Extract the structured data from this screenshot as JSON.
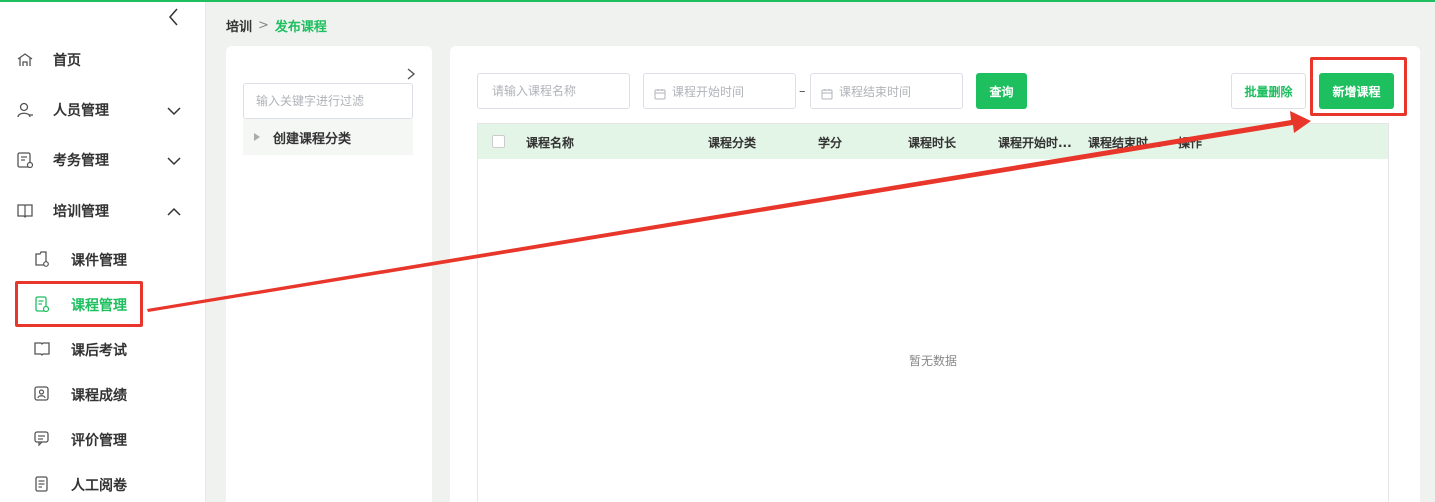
{
  "breadcrumb": {
    "level1": "培训",
    "separator": ">",
    "level2": "发布课程"
  },
  "sidebar": {
    "items": [
      {
        "label": "首页",
        "icon": "home-icon"
      },
      {
        "label": "人员管理",
        "icon": "user-icon",
        "expanded": false
      },
      {
        "label": "考务管理",
        "icon": "exam-doc-icon",
        "expanded": false
      },
      {
        "label": "培训管理",
        "icon": "book-icon",
        "expanded": true
      }
    ],
    "subitems": [
      {
        "label": "课件管理",
        "icon": "courseware-icon"
      },
      {
        "label": "课程管理",
        "icon": "course-icon",
        "active": true
      },
      {
        "label": "课后考试",
        "icon": "test-book-icon"
      },
      {
        "label": "课程成绩",
        "icon": "score-icon"
      },
      {
        "label": "评价管理",
        "icon": "comment-icon"
      },
      {
        "label": "人工阅卷",
        "icon": "grading-doc-icon"
      }
    ]
  },
  "category": {
    "filter_placeholder": "输入关键字进行过滤",
    "node_label": "创建课程分类"
  },
  "toolbar": {
    "name_placeholder": "请输入课程名称",
    "start_placeholder": "课程开始时间",
    "range_separator": "–",
    "end_placeholder": "课程结束时间",
    "query_label": "查询",
    "batch_delete_label": "批量删除",
    "add_course_label": "新增课程"
  },
  "table": {
    "columns": [
      "课程名称",
      "课程分类",
      "学分",
      "课程时长",
      "课程开始时...",
      "课程结束时...",
      "操作"
    ],
    "empty_text": "暂无数据"
  },
  "colors": {
    "accent": "#1dbf5f",
    "annotation": "#e8362b",
    "header_bg": "#e3f5e6"
  }
}
